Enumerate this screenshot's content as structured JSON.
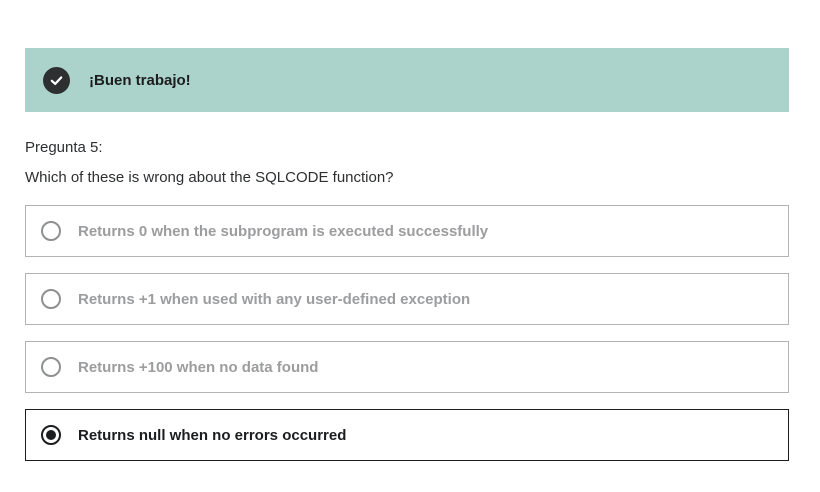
{
  "feedback": {
    "message": "¡Buen trabajo!",
    "icon": "check-circle-icon",
    "background_color": "#acd2cc"
  },
  "question": {
    "number_label": "Pregunta 5:",
    "text": "Which of these is wrong about the SQLCODE function?"
  },
  "options": [
    {
      "label": "Returns 0 when the subprogram is executed successfully",
      "selected": false
    },
    {
      "label": "Returns +1 when used with any user-defined exception",
      "selected": false
    },
    {
      "label": "Returns +100 when no data found",
      "selected": false
    },
    {
      "label": "Returns null when no errors occurred",
      "selected": true
    }
  ]
}
